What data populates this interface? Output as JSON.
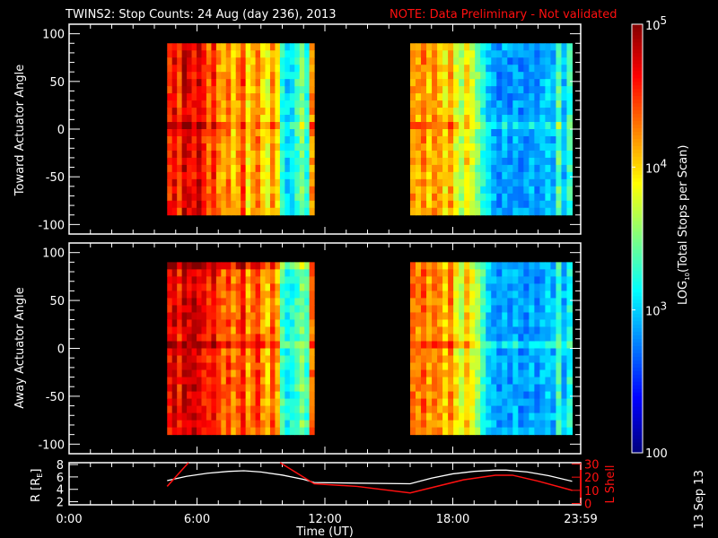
{
  "title": "TWINS2: Stop Counts: 24 Aug (day 236), 2013",
  "note": "NOTE: Data Preliminary - Not validated",
  "stamp": "13 Sep 13",
  "colors": {
    "background": "#000000",
    "axes": "#ffffff",
    "note": "#ff1010",
    "r_line": "#ffffff",
    "l_line": "#ff1010"
  },
  "chart_data": [
    {
      "type": "heatmap",
      "ylabel": "Toward Actuator Angle",
      "ylim": [
        -110,
        110
      ],
      "yticks": [
        "100",
        "50",
        "0",
        "-50",
        "-100"
      ],
      "xlim_hours": [
        0,
        24
      ],
      "angle_range": [
        -90,
        90
      ],
      "blocks": [
        {
          "start_h": 4.6,
          "end_h": 11.5,
          "log_counts": [
            4.5,
            4.7,
            4.4,
            4.8,
            4.7,
            4.6,
            4.8,
            4.5,
            4.3,
            4.6,
            4.2,
            4.1,
            4.3,
            4.0,
            4.2,
            4.5,
            3.9,
            4.1,
            4.3,
            4.0,
            3.8,
            4.2,
            4.0,
            3.2,
            3.0,
            3.1,
            3.3,
            3.5,
            3.2,
            4.2
          ]
        },
        {
          "start_h": 16.0,
          "end_h": 23.6,
          "log_counts": [
            4.2,
            4.1,
            4.3,
            4.0,
            4.2,
            4.1,
            3.9,
            4.2,
            3.8,
            3.6,
            4.0,
            3.7,
            3.5,
            3.2,
            3.0,
            2.9,
            2.8,
            2.9,
            2.8,
            2.9,
            2.8,
            2.8,
            2.9,
            2.8,
            2.9,
            3.0,
            2.9,
            3.4,
            2.9,
            3.3
          ]
        }
      ]
    },
    {
      "type": "heatmap",
      "ylabel": "Away Actuator Angle",
      "ylim": [
        -110,
        110
      ],
      "yticks": [
        "100",
        "50",
        "0",
        "-50",
        "-100"
      ],
      "xlim_hours": [
        0,
        24
      ],
      "angle_range": [
        -90,
        90
      ],
      "blocks": [
        {
          "start_h": 4.6,
          "end_h": 11.5,
          "log_counts": [
            4.6,
            4.8,
            4.5,
            4.8,
            4.7,
            4.8,
            4.7,
            4.6,
            4.5,
            4.7,
            4.4,
            4.3,
            4.5,
            4.2,
            4.4,
            4.6,
            4.1,
            4.3,
            4.5,
            4.2,
            4.0,
            4.4,
            4.1,
            3.3,
            3.1,
            3.2,
            3.3,
            3.5,
            3.3,
            4.3
          ]
        },
        {
          "start_h": 16.0,
          "end_h": 23.6,
          "log_counts": [
            4.3,
            4.2,
            4.4,
            4.1,
            4.3,
            4.2,
            4.0,
            4.3,
            3.9,
            3.7,
            4.1,
            3.8,
            3.6,
            3.3,
            3.0,
            2.9,
            2.8,
            2.9,
            2.8,
            2.9,
            2.8,
            2.8,
            2.9,
            2.8,
            2.9,
            3.0,
            2.9,
            3.3,
            2.9,
            3.2
          ]
        }
      ]
    },
    {
      "type": "line",
      "xlabel": "Time (UT)",
      "xticks": [
        "0:00",
        "6:00",
        "12:00",
        "18:00",
        "23:59"
      ],
      "ylabel": "R [R",
      "ylabel_sub": "E",
      "ylabel_end": "]",
      "ylim": [
        1.5,
        8.3
      ],
      "yticks": [
        "8",
        "6",
        "4",
        "2"
      ],
      "y2label": "L Shell",
      "y2lim": [
        -1,
        31
      ],
      "y2ticks": [
        "30",
        "20",
        "10",
        "0"
      ],
      "series": [
        {
          "name": "R",
          "axis": "left",
          "x": [
            4.6,
            5.5,
            6.5,
            7.5,
            8.2,
            9.0,
            10.0,
            11.0,
            11.5,
            13.5,
            16.0,
            17.0,
            18.0,
            19.0,
            20.0,
            20.5,
            21.5,
            22.5,
            23.6
          ],
          "y": [
            5.4,
            6.1,
            6.6,
            6.9,
            7.0,
            6.8,
            6.3,
            5.6,
            5.1,
            5.0,
            4.9,
            5.8,
            6.5,
            6.9,
            7.1,
            7.1,
            6.8,
            6.2,
            5.3
          ]
        },
        {
          "name": "L Shell",
          "axis": "right",
          "segments": [
            {
              "x": [
                4.6,
                5.6
              ],
              "y": [
                13,
                31
              ]
            },
            {
              "x": [
                9.9,
                11.5,
                13.5,
                16.0,
                17.0,
                18.5,
                20.0,
                20.8,
                22.0,
                23.6
              ],
              "y": [
                31,
                15,
                13,
                8,
                12,
                18,
                21.5,
                21.5,
                17,
                10
              ]
            }
          ]
        }
      ]
    },
    {
      "type": "colorbar",
      "label": "LOG",
      "label_sub": "10",
      "label_rest": "(Total Stops per Scan)",
      "log_range": [
        2,
        5
      ],
      "ticks": [
        {
          "base": "10",
          "exp": "5",
          "log": 5
        },
        {
          "base": "10",
          "exp": "4",
          "log": 4
        },
        {
          "base": "10",
          "exp": "3",
          "log": 3
        },
        {
          "base": "100",
          "exp": "",
          "log": 2
        }
      ]
    }
  ]
}
